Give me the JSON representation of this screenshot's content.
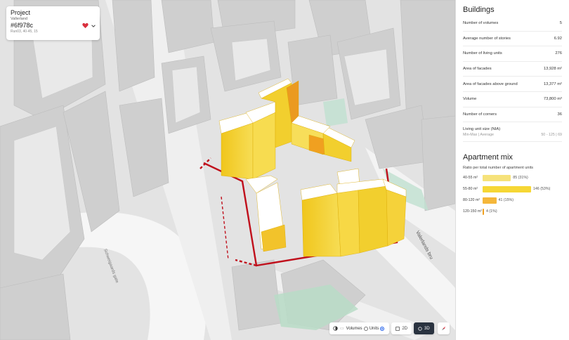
{
  "project": {
    "title": "Project",
    "location": "Vallerland",
    "id": "#6f978c",
    "meta": "Run03, 40-45, 15"
  },
  "colors": {
    "accent_dark": "#2a3340",
    "route_red": "#c0101c",
    "building_yellow": "#f2cf2e",
    "mix_bar_light": "#f6e27a",
    "mix_bar_yellow": "#f6d735",
    "mix_bar_orange": "#f5b73a",
    "mix_bar_deep": "#f0a020"
  },
  "map": {
    "street_label_1": "Valerlands bru",
    "street_label_2": "Schweigaards gate"
  },
  "toolbar": {
    "volumes_label": "Volumes",
    "units_label": "Units",
    "btn_2d": "2D",
    "btn_3d": "3D"
  },
  "panel": {
    "buildings_title": "Buildings",
    "stats": [
      {
        "label": "Number of volumes",
        "value": "5"
      },
      {
        "label": "Average number of stories",
        "value": "6.92"
      },
      {
        "label": "Number of living units",
        "value": "276"
      },
      {
        "label": "Area of facades",
        "value": "13,928 m²"
      },
      {
        "label": "Area of facades above ground",
        "value": "13,377 m²"
      },
      {
        "label": "Volume",
        "value": "73,800 m³"
      },
      {
        "label": "Number of corners",
        "value": "36"
      }
    ],
    "unit_size_label": "Living unit size (NIA)",
    "unit_size_sub": "Min-Max | Average",
    "unit_size_value": "50 - 125 | 69",
    "mix_title": "Apartment mix",
    "mix_subtitle": "Ratio per total number of apartment units",
    "mix": [
      {
        "label": "40-55 m²",
        "value": "85 (31%)",
        "ratio": 0.31,
        "color": "#f6e27a"
      },
      {
        "label": "55-80 m²",
        "value": "146 (53%)",
        "ratio": 0.53,
        "color": "#f6d735"
      },
      {
        "label": "80-120 m²",
        "value": "41 (15%)",
        "ratio": 0.15,
        "color": "#f5b73a"
      },
      {
        "label": "120-150 m²",
        "value": "4 (1%)",
        "ratio": 0.01,
        "color": "#f0a020"
      }
    ]
  }
}
